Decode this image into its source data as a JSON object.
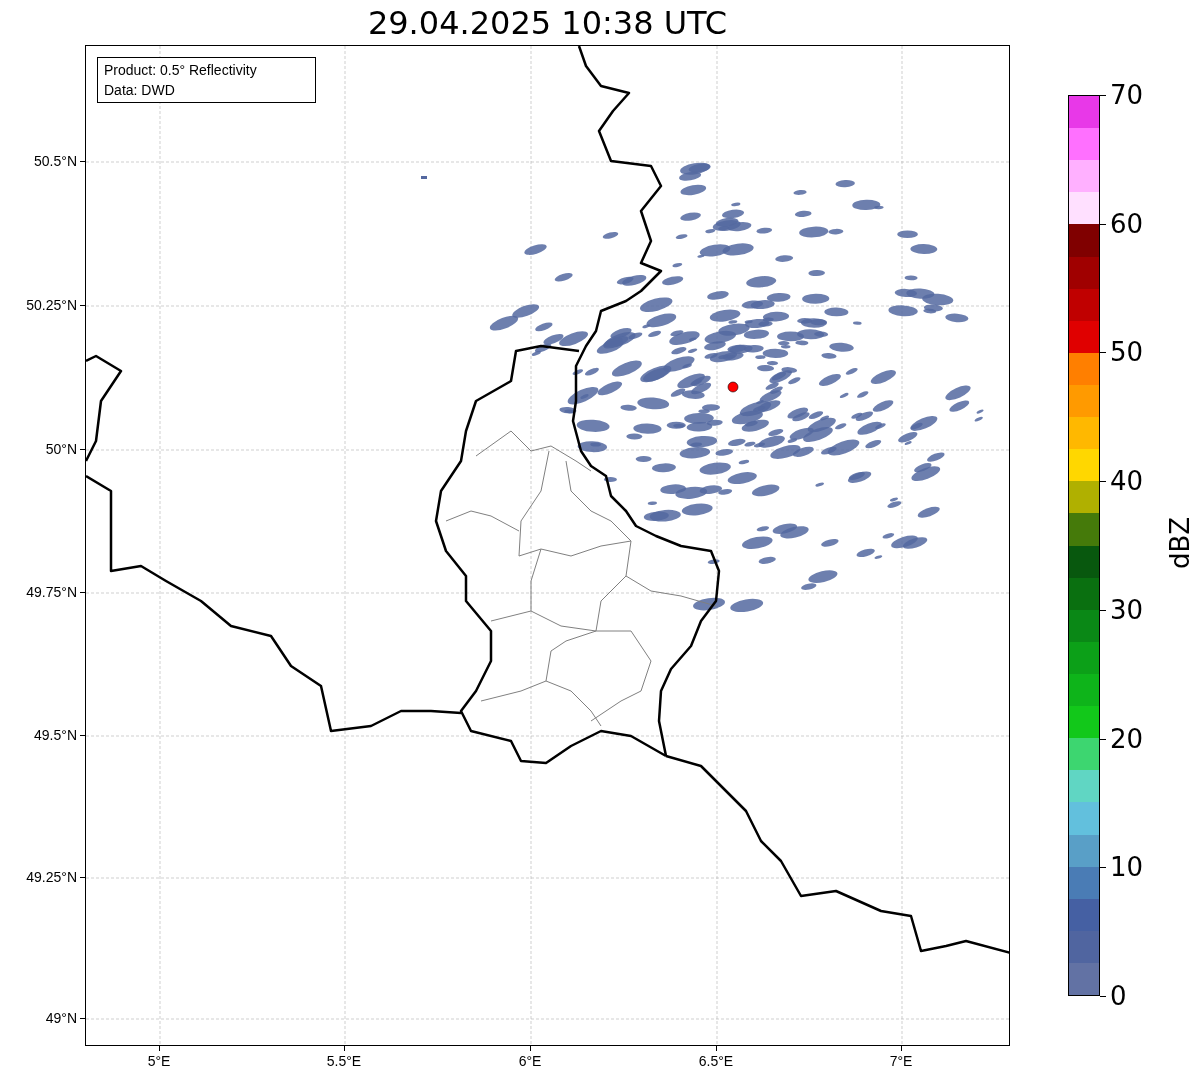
{
  "title": "29.04.2025 10:38 UTC",
  "map": {
    "info_box": [
      "Product: 0.5° Reflectivity",
      "Data: DWD"
    ],
    "lat_ticks": [
      "50.5°N",
      "50.25°N",
      "50°N",
      "49.75°N",
      "49.5°N",
      "49.25°N",
      "49°N"
    ],
    "lon_ticks": [
      "5°E",
      "5.5°E",
      "6°E",
      "6.5°E",
      "7°E"
    ]
  },
  "colorbar": {
    "label": "dBZ",
    "ticks": [
      "70",
      "60",
      "50",
      "40",
      "30",
      "20",
      "10",
      "0"
    ],
    "bands": [
      {
        "color": "#e838e8"
      },
      {
        "color": "#ff70ff"
      },
      {
        "color": "#ffb0ff"
      },
      {
        "color": "#ffe0ff"
      },
      {
        "color": "#800000"
      },
      {
        "color": "#a00000"
      },
      {
        "color": "#c00000"
      },
      {
        "color": "#e00000"
      },
      {
        "color": "#ff7f00"
      },
      {
        "color": "#ff9a00"
      },
      {
        "color": "#ffb800"
      },
      {
        "color": "#ffd700"
      },
      {
        "color": "#b0b000"
      },
      {
        "color": "#457a0a"
      },
      {
        "color": "#08580e"
      },
      {
        "color": "#0a7010"
      },
      {
        "color": "#0a8816"
      },
      {
        "color": "#0ca018"
      },
      {
        "color": "#0eb41a"
      },
      {
        "color": "#12c81a"
      },
      {
        "color": "#3dd670"
      },
      {
        "color": "#60d6c3"
      },
      {
        "color": "#62c0dd"
      },
      {
        "color": "#599fc7"
      },
      {
        "color": "#4a7cb5"
      },
      {
        "color": "#4560a3"
      },
      {
        "color": "#5065a0"
      },
      {
        "color": "#6272a4"
      }
    ]
  }
}
